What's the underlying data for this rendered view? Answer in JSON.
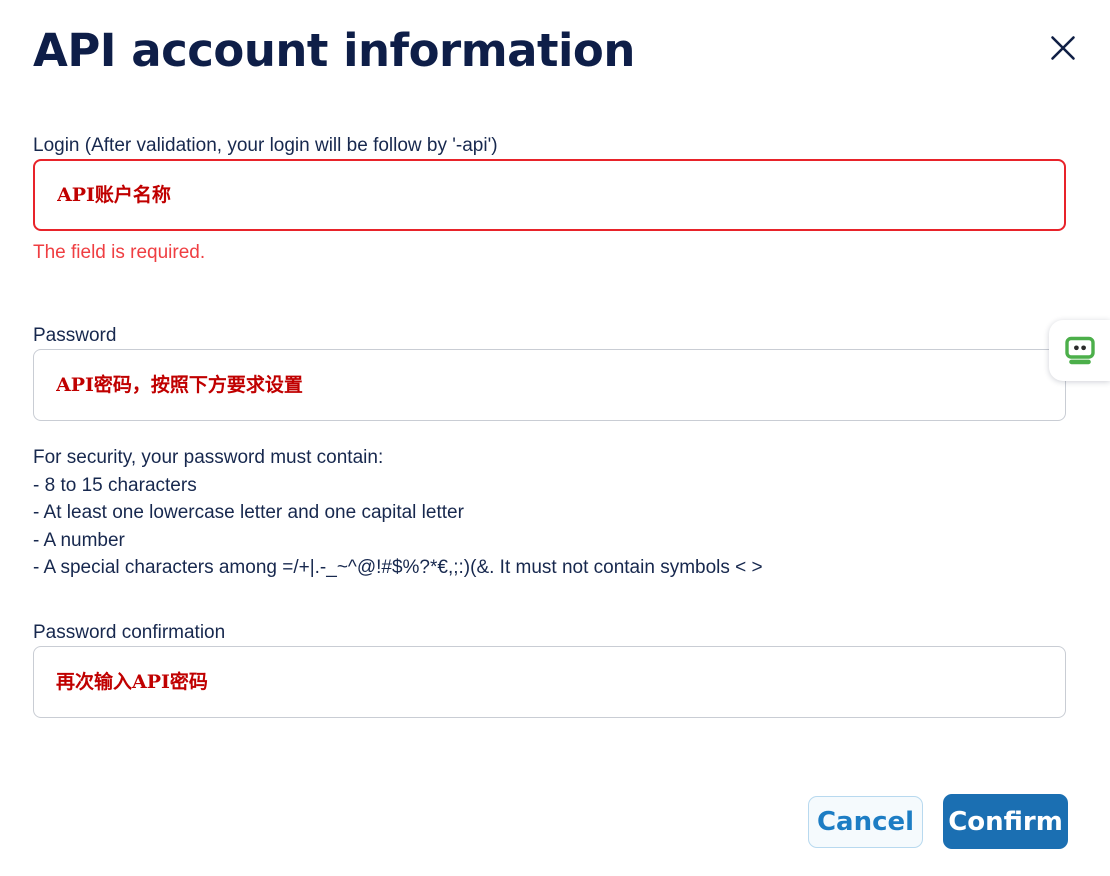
{
  "dialog": {
    "title": "API account information",
    "close_icon": "close-icon"
  },
  "form": {
    "login": {
      "label": "Login (After validation, your login will be follow by '-api')",
      "value": "",
      "placeholder": "API账户名称",
      "error": "The field is required."
    },
    "password": {
      "label": "Password",
      "value": "",
      "placeholder": "API密码，按照下方要求设置"
    },
    "password_hints": "For security, your password must contain:\n- 8 to 15 characters\n- At least one lowercase letter and one capital letter\n- A number\n- A special characters among =/+|.-_~^@!#$%?*€,;:)(&. It must not contain symbols < >",
    "password_confirmation": {
      "label": "Password confirmation",
      "value": "",
      "placeholder": "再次输入API密码"
    }
  },
  "footer": {
    "cancel_label": "Cancel",
    "confirm_label": "Confirm"
  },
  "overlay": {
    "roboform_icon": "robot-icon"
  },
  "colors": {
    "title": "#0e1e48",
    "text": "#17284e",
    "error": "#ef3e42",
    "invalid_border": "#e8232a",
    "placeholder": "#c00000",
    "primary_button": "#1b6fb2",
    "secondary_button_text": "#1d7dc4",
    "robot_green": "#4caf4a"
  }
}
